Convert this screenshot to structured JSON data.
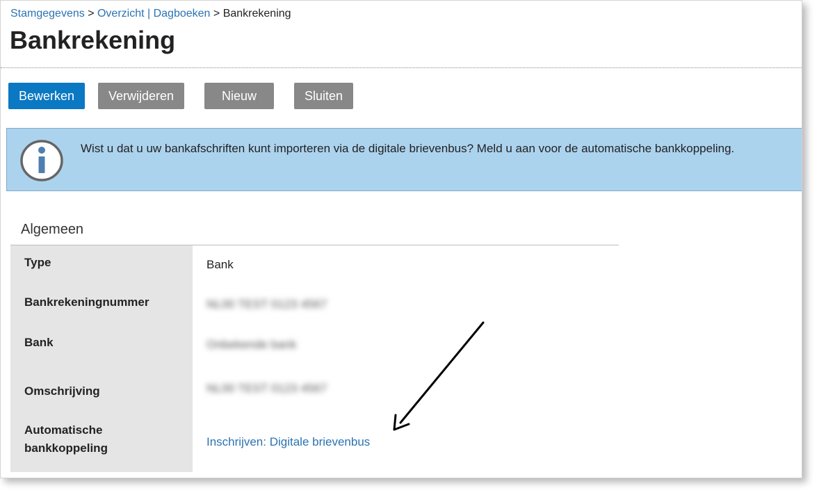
{
  "breadcrumb": {
    "items": [
      "Stamgegevens",
      "Overzicht | Dagboeken",
      "Bankrekening"
    ],
    "separator": ">"
  },
  "page": {
    "title": "Bankrekening"
  },
  "toolbar": {
    "edit_label": "Bewerken",
    "delete_label": "Verwijderen",
    "new_label": "Nieuw",
    "close_label": "Sluiten"
  },
  "info": {
    "icon": "info-icon",
    "text": "Wist u dat u uw bankafschriften kunt importeren via de digitale brievenbus? Meld u aan voor de automatische bankkoppeling."
  },
  "section": {
    "title": "Algemeen",
    "fields": [
      {
        "label": "Type",
        "value": "Bank"
      },
      {
        "label": "Bankrekeningnummer",
        "value": "NL00 TEST 0123 4567"
      },
      {
        "label": "Bank",
        "value": "Onbekende bank"
      },
      {
        "label": "Omschrijving",
        "value": "NL00 TEST 0123 4567"
      },
      {
        "label": "Automatische bankkoppeling",
        "value": "Inschrijven: Digitale brievenbus"
      }
    ]
  },
  "colors": {
    "primary": "#0a78c2",
    "secondary": "#888888",
    "link": "#2a73b3",
    "info_bg": "#acd3ee",
    "label_bg": "#e5e5e5"
  }
}
